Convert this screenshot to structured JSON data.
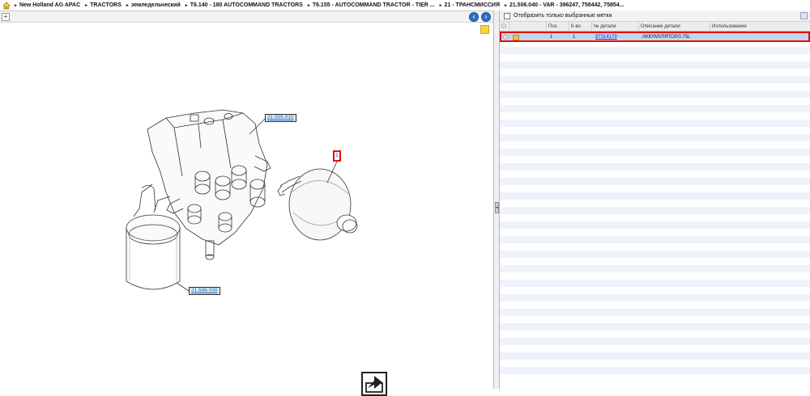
{
  "breadcrumb": {
    "items": [
      "New Holland AG APAC",
      "TRACTORS",
      "земледельческий",
      "T6.140 - 180 AUTOCOMMAND TRACTORS",
      "T6.155 - AUTOCOMMAND TRACTOR - TIER ...",
      "21 - ТРАНСМИССИЯ",
      "21.506.040 - VAR - 396247, 758442, 75854..."
    ],
    "separator": "►"
  },
  "left_toolbar": {
    "expand_symbol": "+",
    "prev_symbol": "‹",
    "next_symbol": "›"
  },
  "drawing": {
    "callouts": {
      "ref_top": "21.505.010",
      "ref_bottom": "21.506.030",
      "item": "1"
    }
  },
  "splitter": {
    "handle_symbol": "◂"
  },
  "right_panel": {
    "filter_label": "Отобразить только выбранные метки",
    "table": {
      "headers": [
        "",
        "",
        "Поз.",
        "К-во",
        "№ детали",
        "Описание детали",
        "Использование"
      ],
      "rows": [
        {
          "pos": "1",
          "qty": "1",
          "part_number": "87314179",
          "description": "АККУМУЛЯТОР,0.75L",
          "usage": ""
        }
      ]
    }
  },
  "colors": {
    "selection_highlight": "#e01010",
    "row_selected": "#c5d5e8",
    "stripe": "#eef2f9",
    "callout_bg": "#d9f2ec",
    "link": "#1a33d6"
  }
}
